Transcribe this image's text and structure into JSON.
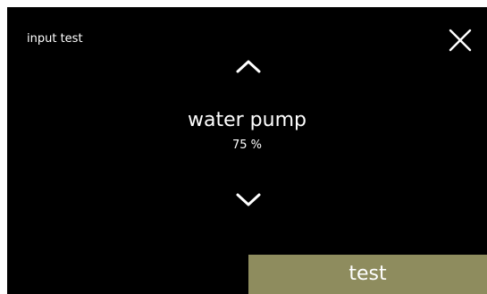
{
  "header": {
    "title": "input test",
    "close_icon": "close-icon"
  },
  "selector": {
    "up_icon": "chevron-up-icon",
    "down_icon": "chevron-down-icon",
    "name": "water pump",
    "value": "75 %"
  },
  "actions": {
    "test_label": "test"
  },
  "colors": {
    "background": "#000000",
    "text": "#ffffff",
    "accent_button": "#8e8c5e"
  }
}
